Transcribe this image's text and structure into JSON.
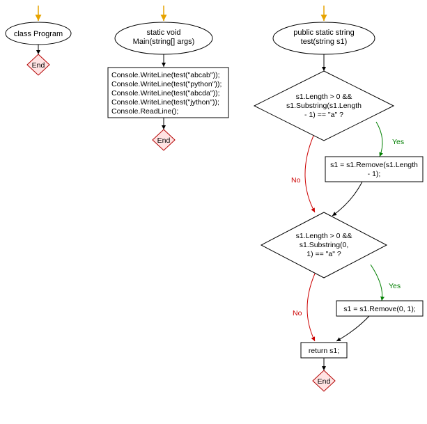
{
  "chart_data": {
    "type": "flowchart",
    "lanes": [
      {
        "title": "class Program",
        "end": "End"
      },
      {
        "title": "static void\nMain(string[] args)",
        "process": "Console.WriteLine(test(\"abcab\"));\nConsole.WriteLine(test(\"python\"));\nConsole.WriteLine(test(\"abcda\"));\nConsole.WriteLine(test(\"jython\"));\nConsole.ReadLine();",
        "end": "End"
      },
      {
        "title": "public static string\ntest(string s1)",
        "decision1": "s1.Length > 0 &&\ns1.Substring(s1.Length\n- 1) == \"a\" ?",
        "d1_yes": "Yes",
        "d1_no": "No",
        "proc1": "s1 = s1.Remove(s1.Length\n- 1);",
        "decision2": "s1.Length > 0 &&\ns1.Substring(0,\n1) == \"a\" ?",
        "d2_yes": "Yes",
        "d2_no": "No",
        "proc2": "s1 = s1.Remove(0, 1);",
        "return": "return s1;",
        "end": "End"
      }
    ]
  },
  "colors": {
    "arrow_entry": "#e6a300",
    "end_border": "#b30000",
    "end_fill": "#ffe3e3",
    "yes_line": "#007f00",
    "no_line": "#cc0000",
    "black": "#000000"
  }
}
